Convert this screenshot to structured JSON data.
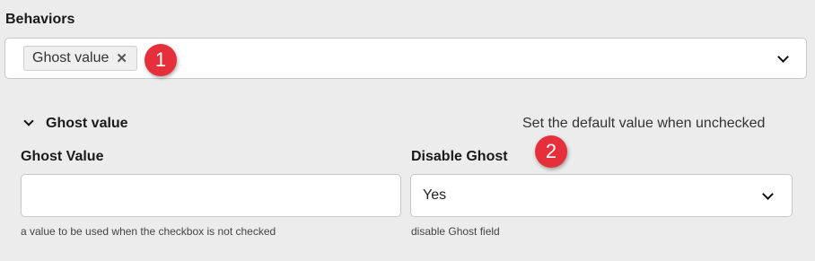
{
  "behaviors": {
    "title": "Behaviors",
    "selected_tags": [
      {
        "label": "Ghost value",
        "remove_glyph": "✕"
      }
    ],
    "dropdown_icon": "chevron-down-icon"
  },
  "annotations": [
    {
      "label": "1"
    },
    {
      "label": "2"
    }
  ],
  "ghost_group": {
    "toggle_label": "Ghost value",
    "hint": "Set the default value when unchecked",
    "ghost_value": {
      "label": "Ghost Value",
      "value": "",
      "placeholder": "",
      "help": "a value to be used when the checkbox is not checked"
    },
    "disable_ghost": {
      "label": "Disable Ghost",
      "selected": "Yes",
      "help": "disable Ghost field"
    }
  },
  "colors": {
    "badge": "#e5303b",
    "background": "#ececec"
  }
}
